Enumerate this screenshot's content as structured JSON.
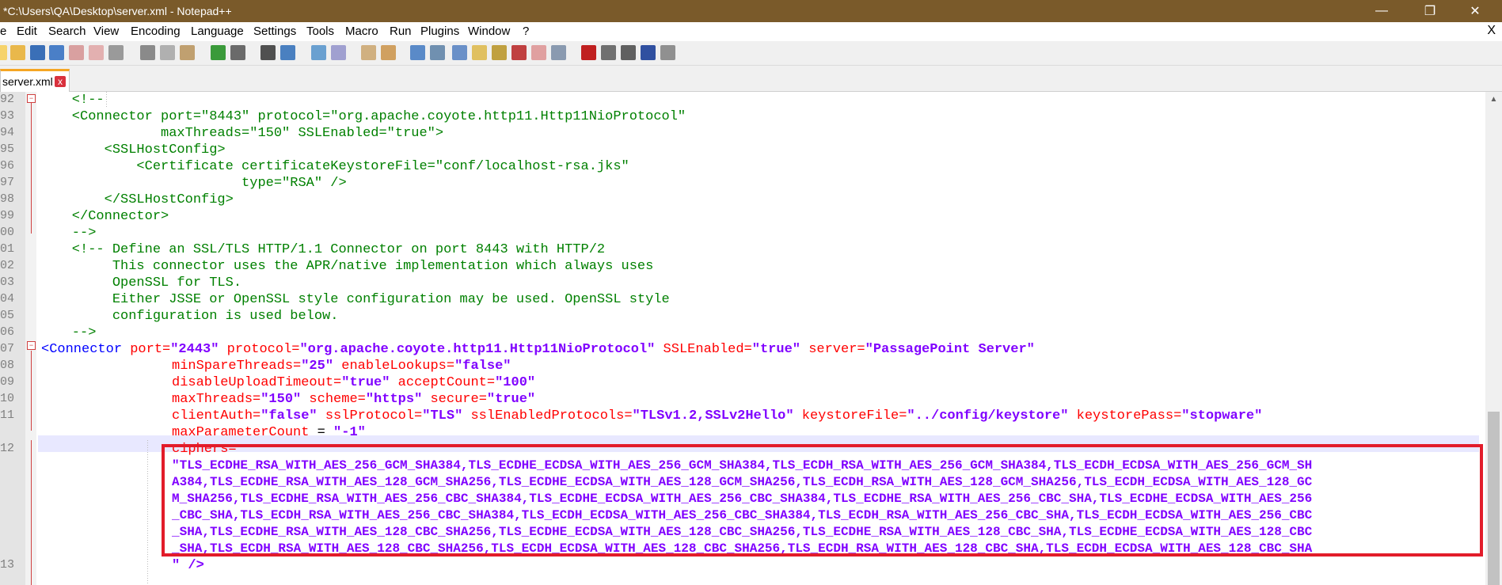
{
  "window": {
    "title": "*C:\\Users\\QA\\Desktop\\server.xml - Notepad++",
    "minimize": "—",
    "maximize": "❐",
    "close": "✕"
  },
  "menu": [
    "e",
    "Edit",
    "Search",
    "View",
    "Encoding",
    "Language",
    "Settings",
    "Tools",
    "Macro",
    "Run",
    "Plugins",
    "Window",
    "?"
  ],
  "menu_close": "X",
  "tab": {
    "label": "server.xml",
    "close": "x"
  },
  "scrollbar": {
    "up": "▲"
  },
  "lines": [
    {
      "n": "92",
      "t": "    <!--"
    },
    {
      "n": "93",
      "t": "    <Connector port=\"8443\" protocol=\"org.apache.coyote.http11.Http11NioProtocol\""
    },
    {
      "n": "94",
      "t": "               maxThreads=\"150\" SSLEnabled=\"true\">"
    },
    {
      "n": "95",
      "t": "        <SSLHostConfig>"
    },
    {
      "n": "96",
      "t": "            <Certificate certificateKeystoreFile=\"conf/localhost-rsa.jks\""
    },
    {
      "n": "97",
      "t": "                         type=\"RSA\" />"
    },
    {
      "n": "98",
      "t": "        </SSLHostConfig>"
    },
    {
      "n": "99",
      "t": "    </Connector>"
    },
    {
      "n": "00",
      "t": "    -->"
    },
    {
      "n": "01",
      "t": "    <!-- Define an SSL/TLS HTTP/1.1 Connector on port 8443 with HTTP/2"
    },
    {
      "n": "02",
      "t": "         This connector uses the APR/native implementation which always uses"
    },
    {
      "n": "03",
      "t": "         OpenSSL for TLS."
    },
    {
      "n": "04",
      "t": "         Either JSSE or OpenSSL style configuration may be used. OpenSSL style"
    },
    {
      "n": "05",
      "t": "         configuration is used below."
    },
    {
      "n": "06",
      "t": "    -->"
    }
  ],
  "code": {
    "l107": {
      "n": "07",
      "a": "<Connector ",
      "b": "port=",
      "c": "\"2443\"",
      "d": " protocol=",
      "e": "\"org.apache.coyote.http11.Http11NioProtocol\"",
      "f": " SSLEnabled=",
      "g": "\"true\"",
      "h": " server=",
      "i": "\"PassagePoint Server\""
    },
    "l108": {
      "n": "08",
      "a": "minSpareThreads=",
      "b": "\"25\"",
      "c": " enableLookups=",
      "d": "\"false\""
    },
    "l109": {
      "n": "09",
      "a": "disableUploadTimeout=",
      "b": "\"true\"",
      "c": " acceptCount=",
      "d": "\"100\""
    },
    "l110": {
      "n": "10",
      "a": "maxThreads=",
      "b": "\"150\"",
      "c": " scheme=",
      "d": "\"https\"",
      "e": " secure=",
      "f": "\"true\""
    },
    "l111": {
      "n": "11",
      "a": "clientAuth=",
      "b": "\"false\"",
      "c": " sslProtocol=",
      "d": "\"TLS\"",
      "e": " sslEnabledProtocols=",
      "f": "\"TLSv1.2,SSLv2Hello\"",
      "g": " keystoreFile=",
      "h": "\"../config/keystore\"",
      "i": " keystorePass=",
      "j": "\"stopware\""
    },
    "l112": {
      "n": "12",
      "a": "maxParameterCount ",
      "b": "= ",
      "c": "\"-1\""
    },
    "l113": {
      "n": "13",
      "a": "ciphers="
    },
    "cipher_lines": [
      "\"TLS_ECDHE_RSA_WITH_AES_256_GCM_SHA384,TLS_ECDHE_ECDSA_WITH_AES_256_GCM_SHA384,TLS_ECDH_RSA_WITH_AES_256_GCM_SHA384,TLS_ECDH_ECDSA_WITH_AES_256_GCM_SH",
      "A384,TLS_ECDHE_RSA_WITH_AES_128_GCM_SHA256,TLS_ECDHE_ECDSA_WITH_AES_128_GCM_SHA256,TLS_ECDH_RSA_WITH_AES_128_GCM_SHA256,TLS_ECDH_ECDSA_WITH_AES_128_GC",
      "M_SHA256,TLS_ECDHE_RSA_WITH_AES_256_CBC_SHA384,TLS_ECDHE_ECDSA_WITH_AES_256_CBC_SHA384,TLS_ECDHE_RSA_WITH_AES_256_CBC_SHA,TLS_ECDHE_ECDSA_WITH_AES_256",
      "_CBC_SHA,TLS_ECDH_RSA_WITH_AES_256_CBC_SHA384,TLS_ECDH_ECDSA_WITH_AES_256_CBC_SHA384,TLS_ECDH_RSA_WITH_AES_256_CBC_SHA,TLS_ECDH_ECDSA_WITH_AES_256_CBC",
      "_SHA,TLS_ECDHE_RSA_WITH_AES_128_CBC_SHA256,TLS_ECDHE_ECDSA_WITH_AES_128_CBC_SHA256,TLS_ECDHE_RSA_WITH_AES_128_CBC_SHA,TLS_ECDHE_ECDSA_WITH_AES_128_CBC",
      "_SHA,TLS_ECDH_RSA_WITH_AES_128_CBC_SHA256,TLS_ECDH_ECDSA_WITH_AES_128_CBC_SHA256,TLS_ECDH_RSA_WITH_AES_128_CBC_SHA,TLS_ECDH_ECDSA_WITH_AES_128_CBC_SHA"
    ],
    "closing": "\" />"
  },
  "gutter_extra": [
    "13"
  ]
}
